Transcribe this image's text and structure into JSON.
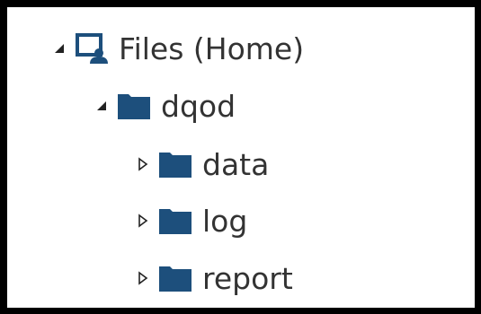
{
  "colors": {
    "accent": "#1d4f7c",
    "text": "#333333",
    "toggle": "#222222",
    "frame": "#000000"
  },
  "tree": {
    "root": {
      "label": "Files (Home)",
      "icon": "home-folder-icon",
      "expanded": true
    },
    "children": [
      {
        "label": "dqod",
        "icon": "folder-icon",
        "expanded": true,
        "children": [
          {
            "label": "data",
            "icon": "folder-icon",
            "expanded": false
          },
          {
            "label": "log",
            "icon": "folder-icon",
            "expanded": false
          },
          {
            "label": "report",
            "icon": "folder-icon",
            "expanded": false
          }
        ]
      }
    ]
  }
}
